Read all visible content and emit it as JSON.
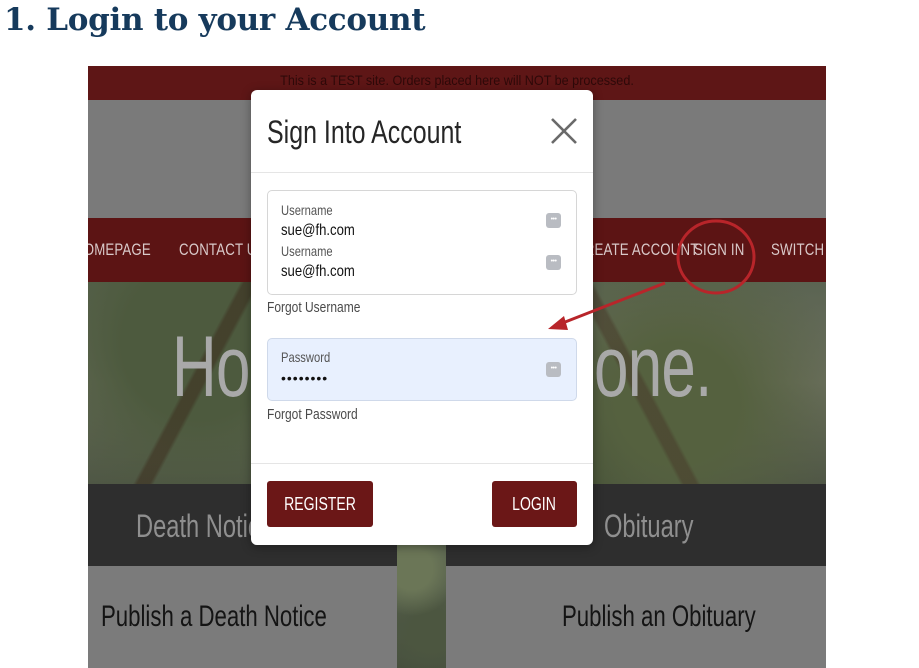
{
  "doc": {
    "heading": "1. Login to your Account"
  },
  "site": {
    "test_banner": "This is a TEST site. Orders placed here will NOT be processed.",
    "nav": {
      "homepage": "HOMEPAGE",
      "contact_us": "CONTACT US",
      "create_account": "CREATE ACCOUNT",
      "sign_in": "SIGN IN",
      "switch": "SWITCH SITE"
    },
    "hero": {
      "left": "Hon",
      "right": "one."
    },
    "strip": {
      "left": "Death Notic",
      "right": "Obituary"
    },
    "cards": {
      "death_notice": "Publish a Death Notice",
      "obituary": "Publish an Obituary"
    }
  },
  "modal": {
    "title": "Sign Into Account",
    "username_label_1": "Username",
    "username_value_1": "sue@fh.com",
    "username_label_2": "Username",
    "username_value_2": "sue@fh.com",
    "forgot_username": "Forgot Username",
    "password_label": "Password",
    "password_value": "••••••••",
    "forgot_password": "Forgot Password",
    "register": "REGISTER",
    "login": "LOGIN"
  },
  "annotation": {
    "color": "#b8252a"
  },
  "icons": {
    "close": "close-icon",
    "autofill": "key-icon"
  }
}
